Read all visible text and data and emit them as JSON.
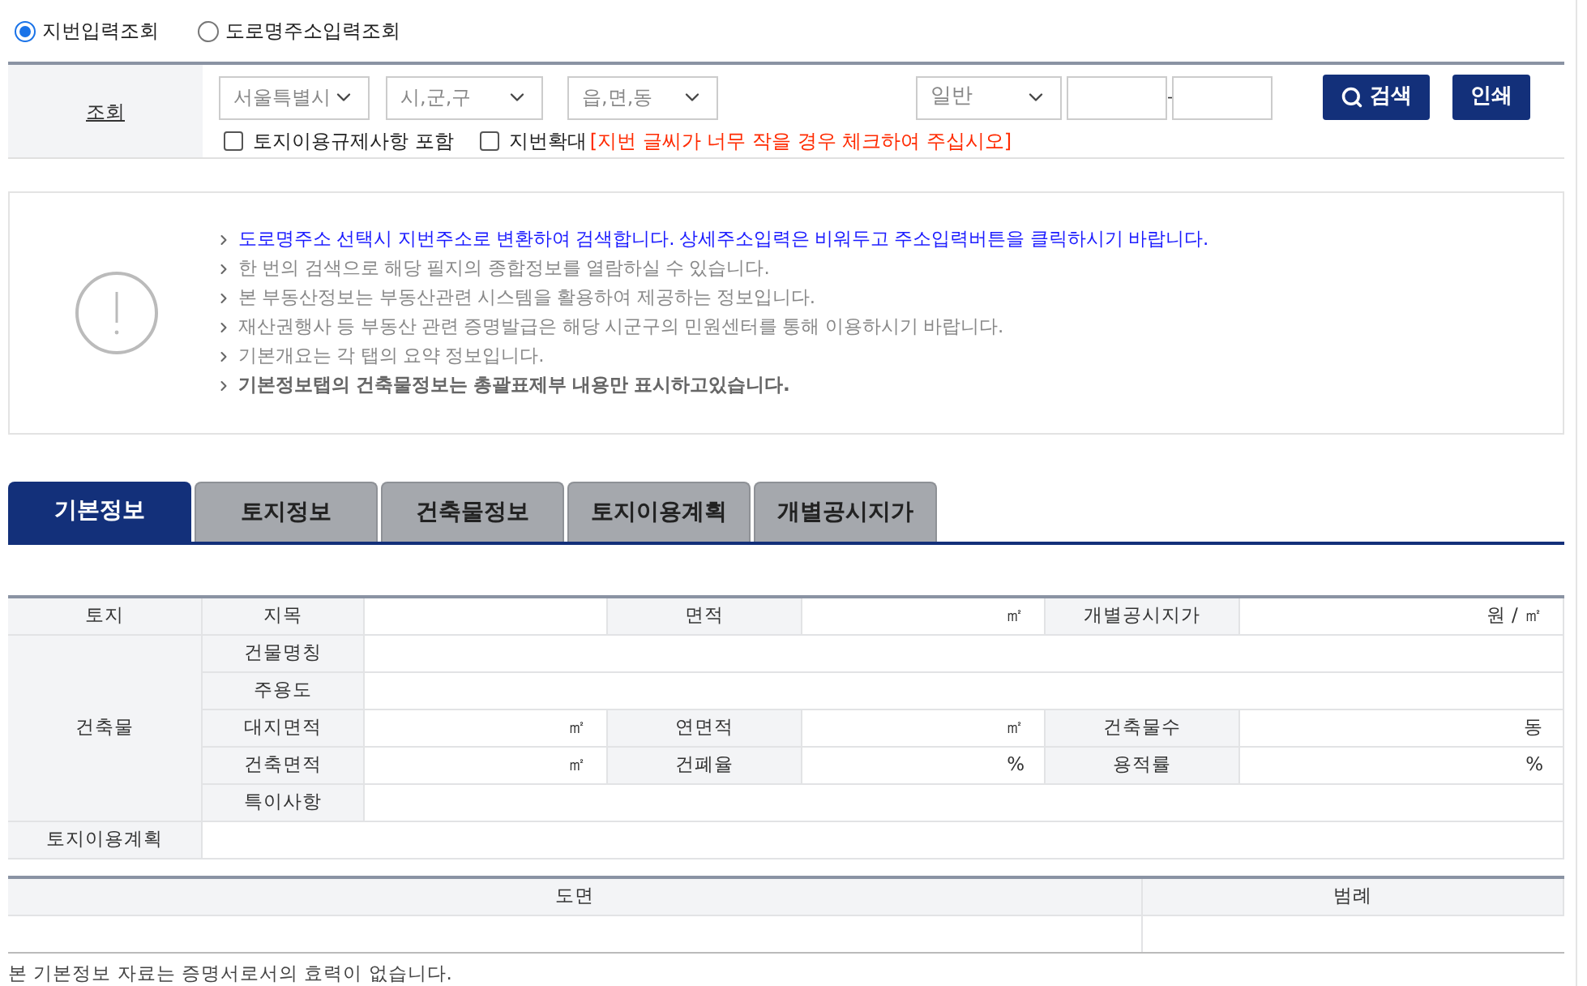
{
  "search_type": [
    {
      "label": "지번입력조회",
      "selected": true
    },
    {
      "label": "도로명주소입력조회",
      "selected": false
    }
  ],
  "search_panel": {
    "label": "조회",
    "selects": [
      {
        "value": "서울특별시"
      },
      {
        "value": "시,군,구"
      },
      {
        "value": "읍,면,동"
      },
      {
        "value": "일반"
      }
    ],
    "separator": "-",
    "checkboxes": [
      {
        "label": "토지이용규제사항 포함",
        "checked": false
      },
      {
        "label": "지번확대",
        "checked": false,
        "note": "[지번 글씨가 너무 작을 경우 체크하여 주십시오]"
      }
    ],
    "buttons": [
      {
        "label": "검색",
        "kind": "search"
      },
      {
        "label": "인쇄",
        "kind": "plain"
      }
    ]
  },
  "notices": [
    {
      "text": "도로명주소 선택시 지번주소로 변환하여 검색합니다. 상세주소입력은 비워두고 주소입력버튼을 클릭하시기 바랍니다.",
      "kind": "highlight"
    },
    {
      "text": "한 번의 검색으로 해당 필지의 종합정보를 열람하실 수 있습니다.",
      "kind": "normal"
    },
    {
      "text": "본 부동산정보는 부동산관련 시스템을 활용하여 제공하는 정보입니다.",
      "kind": "normal"
    },
    {
      "text": "재산권행사 등 부동산 관련 증명발급은 해당 시군구의 민원센터를 통해 이용하시기 바랍니다.",
      "kind": "normal"
    },
    {
      "text": "기본개요는 각 탭의 요약 정보입니다.",
      "kind": "normal"
    },
    {
      "text": "기본정보탭의 건축물정보는 총괄표제부 내용만 표시하고있습니다.",
      "kind": "bold"
    }
  ],
  "tabs": [
    {
      "label": "기본정보",
      "selected": true
    },
    {
      "label": "토지정보",
      "selected": false
    },
    {
      "label": "건축물정보",
      "selected": false
    },
    {
      "label": "토지이용계획",
      "selected": false
    },
    {
      "label": "개별공시지가",
      "selected": false
    }
  ],
  "info_table": {
    "land_header": "토지",
    "land": [
      {
        "label": "지목"
      },
      {
        "label": "면적",
        "unit": "㎡"
      },
      {
        "label": "개별공시지가",
        "unit": "원 / ㎡"
      }
    ],
    "building_header": "건축물",
    "building": [
      [
        {
          "label": "건물명칭"
        }
      ],
      [
        {
          "label": "주용도"
        }
      ],
      [
        {
          "label": "대지면적",
          "unit": "㎡"
        },
        {
          "label": "연면적",
          "unit": "㎡"
        },
        {
          "label": "건축물수",
          "unit": "동"
        }
      ],
      [
        {
          "label": "건축면적",
          "unit": "㎡"
        },
        {
          "label": "건폐율",
          "unit": "%"
        },
        {
          "label": "용적률",
          "unit": "%"
        }
      ],
      [
        {
          "label": "특이사항"
        }
      ]
    ],
    "plan_header": "토지이용계획"
  },
  "map_table": {
    "columns": [
      "도면",
      "범례"
    ]
  },
  "footer": "본 기본정보 자료는 증명서로서의 효력이 없습니다."
}
